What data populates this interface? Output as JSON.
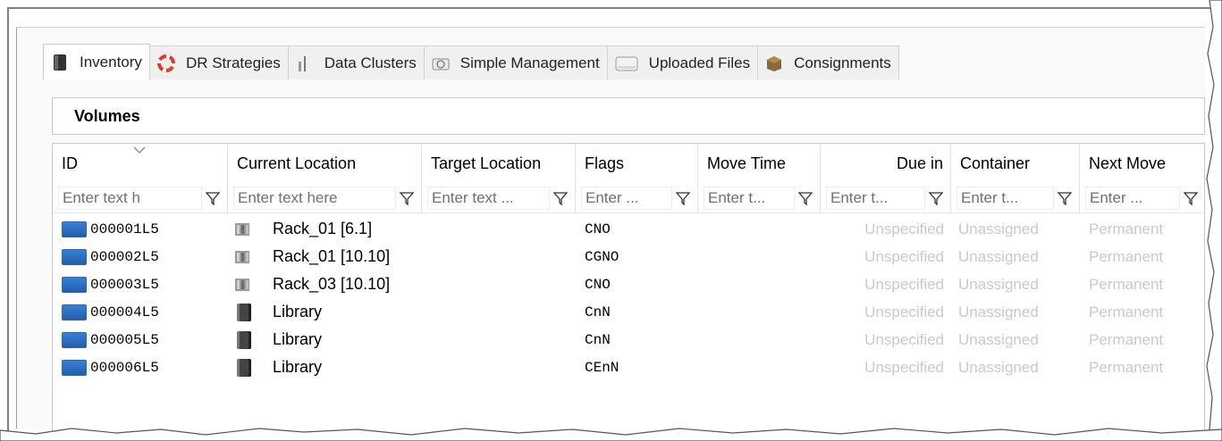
{
  "tabs": [
    {
      "label": "Inventory",
      "icon": "inventory-icon",
      "active": true
    },
    {
      "label": "DR Strategies",
      "icon": "lifebuoy-icon",
      "active": false
    },
    {
      "label": "Data Clusters",
      "icon": "cluster-icon",
      "active": false
    },
    {
      "label": "Simple Management",
      "icon": "management-icon",
      "active": false
    },
    {
      "label": "Uploaded Files",
      "icon": "file-icon",
      "active": false
    },
    {
      "label": "Consignments",
      "icon": "box-icon",
      "active": false
    }
  ],
  "section": {
    "title": "Volumes"
  },
  "columns": [
    {
      "label": "ID",
      "placeholder": "Enter text h"
    },
    {
      "label": "Current Location",
      "placeholder": "Enter text here"
    },
    {
      "label": "Target Location",
      "placeholder": "Enter text ..."
    },
    {
      "label": "Flags",
      "placeholder": "Enter ..."
    },
    {
      "label": "Move Time",
      "placeholder": "Enter t..."
    },
    {
      "label": "Due in",
      "placeholder": "Enter t..."
    },
    {
      "label": "Container",
      "placeholder": "Enter t..."
    },
    {
      "label": "Next Move",
      "placeholder": "Enter ..."
    }
  ],
  "rows": [
    {
      "id": "000001L5",
      "location": "Rack_01 [6.1]",
      "loc_icon": "rack-icon",
      "target": "",
      "flags": "CNO",
      "move_time": "",
      "due_in": "Unspecified",
      "container": "Unassigned",
      "next_move": "Permanent"
    },
    {
      "id": "000002L5",
      "location": "Rack_01 [10.10]",
      "loc_icon": "rack-icon",
      "target": "",
      "flags": "CGNO",
      "move_time": "",
      "due_in": "Unspecified",
      "container": "Unassigned",
      "next_move": "Permanent"
    },
    {
      "id": "000003L5",
      "location": "Rack_03 [10.10]",
      "loc_icon": "rack-icon",
      "target": "",
      "flags": "CNO",
      "move_time": "",
      "due_in": "Unspecified",
      "container": "Unassigned",
      "next_move": "Permanent"
    },
    {
      "id": "000004L5",
      "location": "Library",
      "loc_icon": "library-icon",
      "target": "",
      "flags": "CnN",
      "move_time": "",
      "due_in": "Unspecified",
      "container": "Unassigned",
      "next_move": "Permanent"
    },
    {
      "id": "000005L5",
      "location": "Library",
      "loc_icon": "library-icon",
      "target": "",
      "flags": "CnN",
      "move_time": "",
      "due_in": "Unspecified",
      "container": "Unassigned",
      "next_move": "Permanent"
    },
    {
      "id": "000006L5",
      "location": "Library",
      "loc_icon": "library-icon",
      "target": "",
      "flags": "CEnN",
      "move_time": "",
      "due_in": "Unspecified",
      "container": "Unassigned",
      "next_move": "Permanent"
    }
  ],
  "colors": {
    "accent_volume": "#2a66b5",
    "muted_text": "#c9c9c9"
  }
}
